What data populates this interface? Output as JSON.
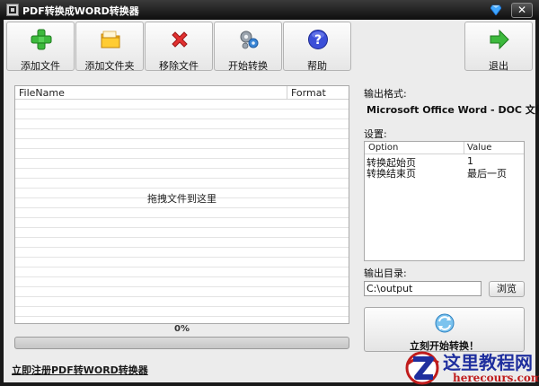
{
  "window": {
    "title": "PDF转换成WORD转换器",
    "close_label": "✕"
  },
  "toolbar": {
    "items": [
      {
        "label": "添加文件",
        "icon": "add-file-icon"
      },
      {
        "label": "添加文件夹",
        "icon": "folder-icon"
      },
      {
        "label": "移除文件",
        "icon": "remove-icon"
      },
      {
        "label": "开始转换",
        "icon": "gears-icon"
      },
      {
        "label": "帮助",
        "icon": "help-icon"
      }
    ],
    "exit_label": "退出",
    "exit_icon": "exit-arrow-icon"
  },
  "file_list": {
    "columns": [
      "FileName",
      "Format"
    ],
    "drop_hint": "拖拽文件到这里"
  },
  "progress": {
    "percent_text": "0%",
    "value": 0
  },
  "register_link": "立即注册PDF转WORD转换器",
  "output": {
    "format_label": "输出格式:",
    "format_value": "Microsoft Office Word - DOC 文件"
  },
  "settings": {
    "label": "设置:",
    "columns": [
      "Option",
      "Value"
    ],
    "rows": [
      {
        "option": "转换起始页",
        "value": "1"
      },
      {
        "option": "转换结束页",
        "value": "最后一页"
      }
    ]
  },
  "output_dir": {
    "label": "输出目录:",
    "value": "C:\\output",
    "browse_label": "浏览"
  },
  "start_button": {
    "label": "立刻开始转换！",
    "icon": "convert-icon"
  },
  "watermark": {
    "title": "这里教程网",
    "url": "herecours.com"
  },
  "colors": {
    "titlebar": "#1a1a1a",
    "panel": "#ececec",
    "watermark_blue": "#1f2f9e",
    "watermark_red": "#c01c1c",
    "progress_fill": "#4a90d9"
  }
}
